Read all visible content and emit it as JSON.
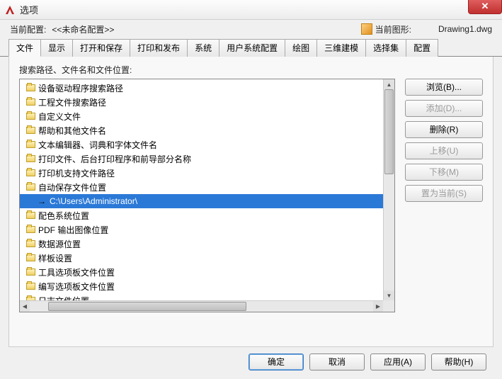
{
  "window": {
    "title": "选项",
    "close_glyph": "✕"
  },
  "info": {
    "profile_label": "当前配置:",
    "profile_value": "<<未命名配置>>",
    "drawing_label": "当前图形:",
    "drawing_value": "Drawing1.dwg"
  },
  "tabs": [
    "文件",
    "显示",
    "打开和保存",
    "打印和发布",
    "系统",
    "用户系统配置",
    "绘图",
    "三维建模",
    "选择集",
    "配置"
  ],
  "active_tab": 0,
  "section_label": "搜索路径、文件名和文件位置:",
  "tree": [
    {
      "label": "设备驱动程序搜索路径",
      "type": "folder"
    },
    {
      "label": "工程文件搜索路径",
      "type": "folder"
    },
    {
      "label": "自定义文件",
      "type": "folder"
    },
    {
      "label": "帮助和其他文件名",
      "type": "folder"
    },
    {
      "label": "文本编辑器、词典和字体文件名",
      "type": "folder"
    },
    {
      "label": "打印文件、后台打印程序和前导部分名称",
      "type": "folder"
    },
    {
      "label": "打印机支持文件路径",
      "type": "folder"
    },
    {
      "label": "自动保存文件位置",
      "type": "folder"
    },
    {
      "label": "C:\\Users\\Administrator\\",
      "type": "path",
      "selected": true
    },
    {
      "label": "配色系统位置",
      "type": "folder"
    },
    {
      "label": "PDF 输出图像位置",
      "type": "folder"
    },
    {
      "label": "数据源位置",
      "type": "folder"
    },
    {
      "label": "样板设置",
      "type": "folder"
    },
    {
      "label": "工具选项板文件位置",
      "type": "folder"
    },
    {
      "label": "编写选项板文件位置",
      "type": "folder"
    },
    {
      "label": "日志文件位置",
      "type": "folder"
    }
  ],
  "side_buttons": [
    {
      "label": "浏览(B)...",
      "disabled": false
    },
    {
      "label": "添加(D)...",
      "disabled": true
    },
    {
      "label": "删除(R)",
      "disabled": false
    },
    {
      "label": "上移(U)",
      "disabled": true
    },
    {
      "label": "下移(M)",
      "disabled": true
    },
    {
      "label": "置为当前(S)",
      "disabled": true
    }
  ],
  "bottom_buttons": {
    "ok": "确定",
    "cancel": "取消",
    "apply": "应用(A)",
    "help": "帮助(H)"
  }
}
